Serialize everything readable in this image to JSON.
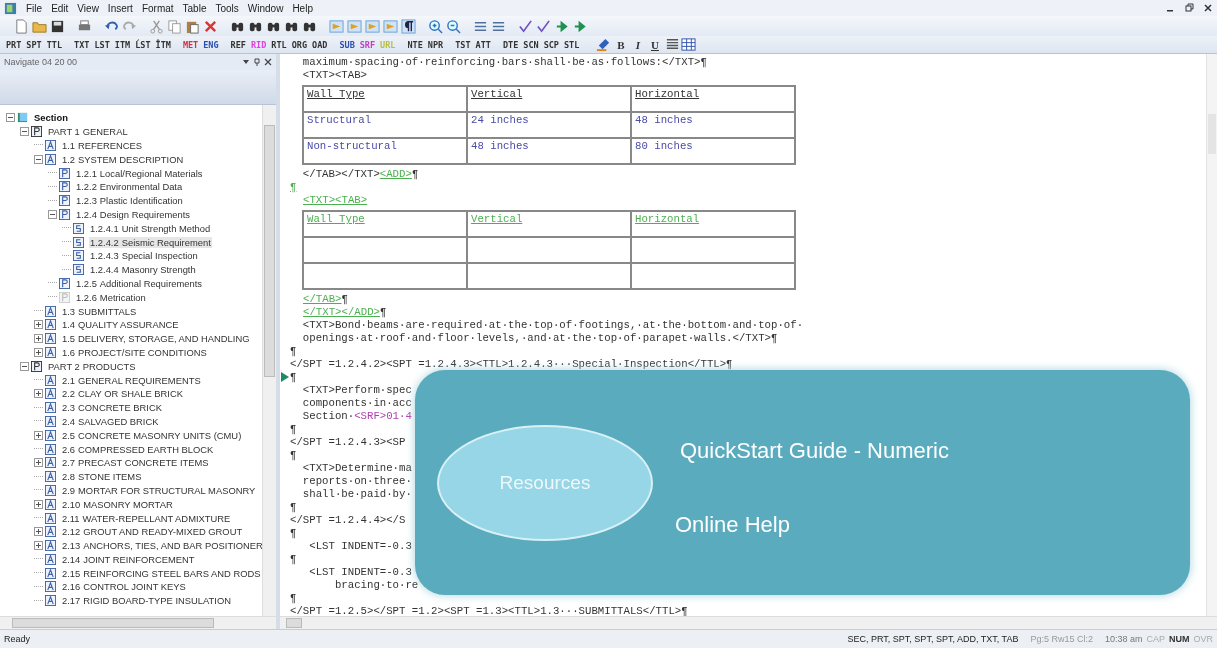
{
  "menu": [
    "File",
    "Edit",
    "View",
    "Insert",
    "Format",
    "Table",
    "Tools",
    "Window",
    "Help"
  ],
  "tag_groups": [
    {
      "tags": [
        {
          "label": "PRT"
        },
        {
          "label": "SPT"
        },
        {
          "label": "TTL"
        }
      ]
    },
    {
      "tags": [
        {
          "label": "TXT"
        },
        {
          "label": "LST"
        },
        {
          "label": "ITM"
        },
        {
          "label": "ĹST"
        },
        {
          "label": "ÎTM"
        }
      ]
    },
    {
      "tags": [
        {
          "label": "MET",
          "color": "#d0304a"
        },
        {
          "label": "ENG",
          "color": "#2a4fb0"
        }
      ]
    },
    {
      "tags": [
        {
          "label": "REF"
        },
        {
          "label": "RID",
          "color": "#e040e0"
        },
        {
          "label": "RTL"
        },
        {
          "label": "ORG"
        },
        {
          "label": "OAD"
        }
      ]
    },
    {
      "tags": [
        {
          "label": "SUB",
          "color": "#2a4fb0"
        },
        {
          "label": "SRF",
          "color": "#c040c0"
        },
        {
          "label": "URL",
          "color": "#b8c040"
        }
      ]
    },
    {
      "tags": [
        {
          "label": "NTE"
        },
        {
          "label": "NPR"
        }
      ]
    },
    {
      "tags": [
        {
          "label": "TST"
        },
        {
          "label": "ATT"
        }
      ]
    },
    {
      "tags": [
        {
          "label": "DTE"
        },
        {
          "label": "SCN"
        },
        {
          "label": "SCP"
        },
        {
          "label": "STL"
        }
      ]
    }
  ],
  "format_buttons": [
    "B",
    "I",
    "U"
  ],
  "navigator": {
    "title": "Navigate 04 20 00"
  },
  "tree": {
    "items": [
      {
        "kind": "section",
        "number": "Section",
        "expanded": true,
        "selected": false,
        "children": [
          {
            "kind": "part",
            "number": "PART 1",
            "title": "GENERAL",
            "expanded": true,
            "selected": false,
            "children": [
              {
                "kind": "article",
                "number": "1.1",
                "title": "REFERENCES",
                "selected": false
              },
              {
                "kind": "article",
                "number": "1.2",
                "title": "SYSTEM DESCRIPTION",
                "expanded": true,
                "selected": false,
                "children": [
                  {
                    "kind": "paragraph",
                    "number": "1.2.1",
                    "title": "Local/Regional Materials",
                    "selected": false
                  },
                  {
                    "kind": "paragraph",
                    "number": "1.2.2",
                    "title": "Environmental Data",
                    "selected": false
                  },
                  {
                    "kind": "paragraph",
                    "number": "1.2.3",
                    "title": "Plastic Identification",
                    "selected": false
                  },
                  {
                    "kind": "paragraph",
                    "number": "1.2.4",
                    "title": "Design Requirements",
                    "expanded": true,
                    "selected": false,
                    "children": [
                      {
                        "kind": "subparagraph",
                        "number": "1.2.4.1",
                        "title": "Unit Strength Method",
                        "selected": false
                      },
                      {
                        "kind": "subparagraph",
                        "number": "1.2.4.2",
                        "title": "Seismic Requirement",
                        "selected": true
                      },
                      {
                        "kind": "subparagraph",
                        "number": "1.2.4.3",
                        "title": "Special Inspection",
                        "selected": false
                      },
                      {
                        "kind": "subparagraph",
                        "number": "1.2.4.4",
                        "title": "Masonry Strength",
                        "selected": false
                      }
                    ]
                  },
                  {
                    "kind": "paragraph",
                    "number": "1.2.5",
                    "title": "Additional Requirements",
                    "selected": false
                  },
                  {
                    "kind": "faded",
                    "number": "1.2.6",
                    "title": "Metrication",
                    "selected": false
                  }
                ]
              },
              {
                "kind": "article",
                "number": "1.3",
                "title": "SUBMITTALS",
                "selected": false
              },
              {
                "kind": "article",
                "number": "1.4",
                "title": "QUALITY ASSURANCE",
                "expanded": false,
                "selected": false
              },
              {
                "kind": "article",
                "number": "1.5",
                "title": "DELIVERY, STORAGE, AND HANDLING",
                "expanded": false,
                "selected": false
              },
              {
                "kind": "article",
                "number": "1.6",
                "title": "PROJECT/SITE CONDITIONS",
                "expanded": false,
                "selected": false
              }
            ]
          },
          {
            "kind": "part",
            "number": "PART 2",
            "title": "PRODUCTS",
            "expanded": true,
            "selected": false,
            "children": [
              {
                "kind": "article",
                "number": "2.1",
                "title": "GENERAL REQUIREMENTS",
                "selected": false
              },
              {
                "kind": "article",
                "number": "2.2",
                "title": "CLAY OR SHALE BRICK",
                "expanded": false,
                "selected": false
              },
              {
                "kind": "article",
                "number": "2.3",
                "title": "CONCRETE BRICK",
                "selected": false
              },
              {
                "kind": "article",
                "number": "2.4",
                "title": "SALVAGED BRICK",
                "selected": false
              },
              {
                "kind": "article",
                "number": "2.5",
                "title": "CONCRETE MASONRY UNITS (CMU)",
                "expanded": false,
                "selected": false
              },
              {
                "kind": "article",
                "number": "2.6",
                "title": "COMPRESSED EARTH BLOCK",
                "selected": false
              },
              {
                "kind": "article",
                "number": "2.7",
                "title": "PRECAST CONCRETE ITEMS",
                "expanded": false,
                "selected": false
              },
              {
                "kind": "article",
                "number": "2.8",
                "title": "STONE ITEMS",
                "selected": false
              },
              {
                "kind": "article",
                "number": "2.9",
                "title": "MORTAR FOR STRUCTURAL MASONRY",
                "selected": false
              },
              {
                "kind": "article",
                "number": "2.10",
                "title": "MASONRY MORTAR",
                "expanded": false,
                "selected": false
              },
              {
                "kind": "article",
                "number": "2.11",
                "title": "WATER-REPELLANT ADMIXTURE",
                "selected": false
              },
              {
                "kind": "article",
                "number": "2.12",
                "title": "GROUT AND READY-MIXED GROUT",
                "expanded": false,
                "selected": false
              },
              {
                "kind": "article",
                "number": "2.13",
                "title": "ANCHORS, TIES, AND BAR POSITIONER",
                "expanded": false,
                "selected": false
              },
              {
                "kind": "article",
                "number": "2.14",
                "title": "JOINT REINFORCEMENT",
                "selected": false
              },
              {
                "kind": "article",
                "number": "2.15",
                "title": "REINFORCING STEEL BARS AND RODS",
                "selected": false
              },
              {
                "kind": "article",
                "number": "2.16",
                "title": "CONTROL JOINT KEYS",
                "selected": false
              },
              {
                "kind": "article",
                "number": "2.17",
                "title": "RIGID BOARD-TYPE INSULATION",
                "selected": false
              }
            ]
          }
        ]
      }
    ]
  },
  "editor": {
    "lines": [
      {
        "kind": "text",
        "segments": [
          {
            "text": "  maximum·spacing·of·reinforcing·bars·shall·be·as·follows:</TXT>¶",
            "kind": "plain"
          }
        ]
      },
      {
        "kind": "text",
        "segments": [
          {
            "text": "  <TXT><TAB>",
            "kind": "plain"
          }
        ]
      },
      {
        "kind": "table",
        "added": false,
        "rows": [
          {
            "header": true,
            "cells": [
              {
                "text": "Wall Type"
              },
              {
                "text": "Vertical"
              },
              {
                "text": "Horizontal"
              }
            ]
          },
          {
            "header": false,
            "cells": [
              {
                "text": "Structural"
              },
              {
                "text": "24 inches"
              },
              {
                "text": "48 inches"
              }
            ]
          },
          {
            "header": false,
            "cells": [
              {
                "text": "Non-structural"
              },
              {
                "text": "48 inches"
              },
              {
                "text": "80 inches"
              }
            ]
          }
        ]
      },
      {
        "kind": "text",
        "segments": [
          {
            "text": "  </TAB></TXT>",
            "kind": "plain"
          },
          {
            "text": "<ADD>",
            "kind": "added"
          },
          {
            "text": "¶",
            "kind": "plain"
          }
        ]
      },
      {
        "kind": "text",
        "segments": [
          {
            "text": "¶",
            "kind": "added"
          }
        ]
      },
      {
        "kind": "text",
        "indented": true,
        "segments": [
          {
            "text": "<TXT><TAB>",
            "kind": "added"
          }
        ]
      },
      {
        "kind": "table",
        "added": true,
        "rows": [
          {
            "header": true,
            "cells": [
              {
                "text": "Wall Type"
              },
              {
                "text": "Vertical"
              },
              {
                "text": "Horizontal"
              }
            ]
          },
          {
            "header": false,
            "cells": [
              {
                "blank": true
              },
              {
                "blank": true
              },
              {
                "blank": true
              }
            ]
          },
          {
            "header": false,
            "cells": [
              {
                "blank": true
              },
              {
                "blank": true
              },
              {
                "blank": true
              }
            ]
          }
        ]
      },
      {
        "kind": "text",
        "indented": true,
        "segments": [
          {
            "text": "</TAB>",
            "kind": "added"
          },
          {
            "text": "¶",
            "kind": "plain"
          }
        ]
      },
      {
        "kind": "text",
        "indented": true,
        "segments": [
          {
            "text": "</TXT></ADD>",
            "kind": "added"
          },
          {
            "text": "¶",
            "kind": "plain"
          }
        ]
      },
      {
        "kind": "text",
        "segments": [
          {
            "text": "  <TXT>Bond·beams·are·required·at·the·top·of·footings,·at·the·bottom·and·top·of·",
            "kind": "plain"
          }
        ]
      },
      {
        "kind": "text",
        "segments": [
          {
            "text": "  openings·at·roof·and·floor·levels,·and·at·the·top·of·parapet·walls.</TXT>¶",
            "kind": "plain"
          }
        ]
      },
      {
        "kind": "text",
        "segments": [
          {
            "text": "¶",
            "kind": "plain"
          }
        ]
      },
      {
        "kind": "text",
        "segments": [
          {
            "text": "</SPT =1.2.4.2><SPT =1.2.4.3><TTL>1.2.4.3···Special·Inspection</TTL>¶",
            "kind": "plain"
          }
        ]
      },
      {
        "kind": "text",
        "marker": true,
        "segments": [
          {
            "text": "¶",
            "kind": "plain"
          }
        ]
      },
      {
        "kind": "text",
        "segments": [
          {
            "text": "  <TXT>Perform·spec",
            "kind": "plain"
          }
        ]
      },
      {
        "kind": "text",
        "segments": [
          {
            "text": "  components·in·acc",
            "kind": "plain"
          }
        ]
      },
      {
        "kind": "text",
        "segments": [
          {
            "text": "  Section·",
            "kind": "plain"
          },
          {
            "text": "<SRF>01·4",
            "kind": "ref"
          }
        ]
      },
      {
        "kind": "text",
        "segments": [
          {
            "text": "¶",
            "kind": "plain"
          }
        ]
      },
      {
        "kind": "text",
        "segments": [
          {
            "text": "</SPT =1.2.4.3><SP",
            "kind": "plain"
          }
        ]
      },
      {
        "kind": "text",
        "segments": [
          {
            "text": "¶",
            "kind": "plain"
          }
        ]
      },
      {
        "kind": "text",
        "segments": [
          {
            "text": "  <TXT>Determine·ma",
            "kind": "plain"
          }
        ]
      },
      {
        "kind": "text",
        "segments": [
          {
            "text": "  reports·on·three·",
            "kind": "plain"
          }
        ]
      },
      {
        "kind": "text",
        "segments": [
          {
            "text": "  shall·be·paid·by·",
            "kind": "plain"
          }
        ]
      },
      {
        "kind": "text",
        "segments": [
          {
            "text": "¶",
            "kind": "plain"
          }
        ]
      },
      {
        "kind": "text",
        "segments": [
          {
            "text": "</SPT =1.2.4.4></S",
            "kind": "plain"
          }
        ]
      },
      {
        "kind": "text",
        "segments": [
          {
            "text": "¶",
            "kind": "plain"
          }
        ]
      },
      {
        "kind": "text",
        "segments": [
          {
            "text": "   <LST INDENT=-0.3",
            "kind": "plain"
          }
        ]
      },
      {
        "kind": "text",
        "segments": [
          {
            "text": "¶",
            "kind": "plain"
          }
        ]
      },
      {
        "kind": "text",
        "segments": [
          {
            "text": "   <LST INDENT=-0.3",
            "kind": "plain"
          }
        ]
      },
      {
        "kind": "text",
        "segments": [
          {
            "text": "       bracing·to·re",
            "kind": "plain"
          }
        ]
      },
      {
        "kind": "text",
        "segments": [
          {
            "text": "¶",
            "kind": "plain"
          }
        ]
      },
      {
        "kind": "text",
        "segments": [
          {
            "text": "</SPT =1.2.5></SPT =1.2><SPT =1.3><TTL>1.3···SUBMITTALS</TTL>¶",
            "kind": "plain"
          }
        ]
      }
    ]
  },
  "overlay": {
    "circle": "Resources",
    "links": [
      "QuickStart Guide - Numeric",
      "Online Help"
    ]
  },
  "status_bar": {
    "message": "Ready",
    "context": "SEC, PRT, SPT, SPT, SPT, ADD, TXT, TAB",
    "position": "Pg:5 Rw15 Cl:2",
    "time": "10:38 am",
    "keys": [
      {
        "label": "CAP",
        "on": false
      },
      {
        "label": "NUM",
        "on": true
      },
      {
        "label": "OVR",
        "on": false
      }
    ]
  }
}
